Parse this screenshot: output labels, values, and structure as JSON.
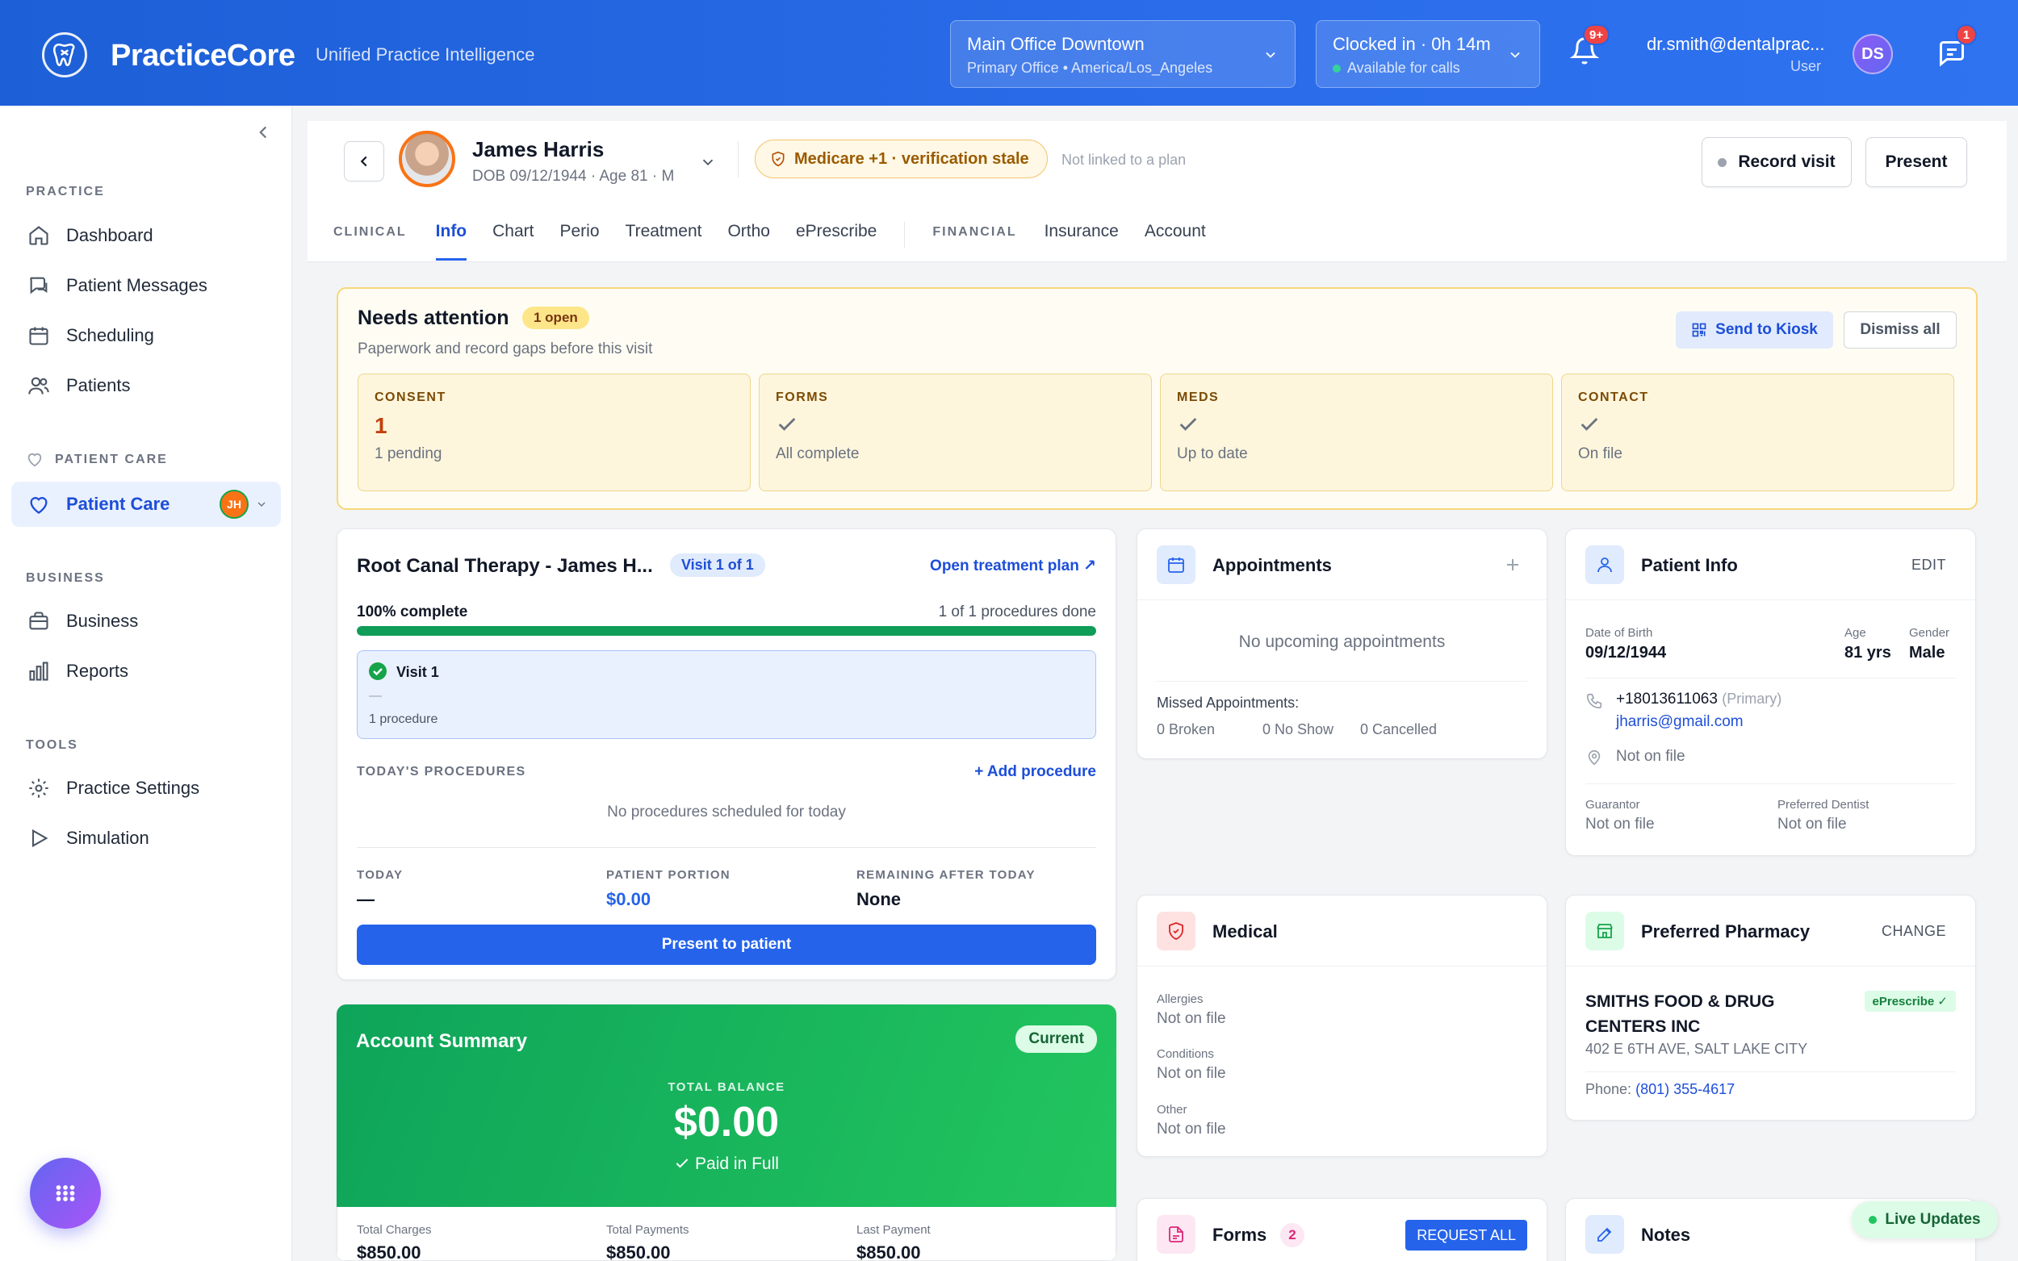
{
  "app": {
    "name": "PracticeCore",
    "tagline": "Unified Practice Intelligence"
  },
  "topbar": {
    "office": {
      "name": "Main Office Downtown",
      "detail": "Primary Office • America/Los_Angeles"
    },
    "clock": {
      "status": "Clocked in · 0h 14m",
      "availability": "Available for calls"
    },
    "notifications_badge": "9+",
    "user": {
      "email": "dr.smith@dentalprac...",
      "role": "User",
      "initials": "DS"
    },
    "messages_badge": "1"
  },
  "sidebar": {
    "sections": {
      "practice": "PRACTICE",
      "patient_care": "PATIENT CARE",
      "business": "BUSINESS",
      "tools": "TOOLS"
    },
    "items": {
      "dashboard": "Dashboard",
      "messages": "Patient Messages",
      "scheduling": "Scheduling",
      "patients": "Patients",
      "patient_care": "Patient Care",
      "patient_care_initials": "JH",
      "business": "Business",
      "reports": "Reports",
      "settings": "Practice Settings",
      "simulation": "Simulation"
    }
  },
  "patient": {
    "name": "James Harris",
    "dob_line": "DOB 09/12/1944 · Age 81 · M",
    "insurance_badge": "Medicare +1 · verification stale",
    "plan_note": "Not linked to a plan",
    "record_visit": "Record visit",
    "present": "Present"
  },
  "tabs": {
    "clinical": "CLINICAL",
    "info": "Info",
    "chart": "Chart",
    "perio": "Perio",
    "treatment": "Treatment",
    "ortho": "Ortho",
    "eprescribe": "ePrescribe",
    "financial": "FINANCIAL",
    "insurance": "Insurance",
    "account": "Account"
  },
  "attention": {
    "title": "Needs attention",
    "count": "1 open",
    "subtitle": "Paperwork and record gaps before this visit",
    "kiosk": "Send to Kiosk",
    "dismiss": "Dismiss all",
    "cards": {
      "consent": {
        "label": "CONSENT",
        "value": "1",
        "sub": "1 pending"
      },
      "forms": {
        "label": "FORMS",
        "sub": "All complete"
      },
      "meds": {
        "label": "MEDS",
        "sub": "Up to date"
      },
      "contact": {
        "label": "CONTACT",
        "sub": "On file"
      }
    }
  },
  "treatment": {
    "title": "Root Canal Therapy - James H...",
    "visit_badge": "Visit 1 of 1",
    "open_link": "Open treatment plan ↗",
    "progress_label": "100% complete",
    "progress_detail": "1 of 1 procedures done",
    "progress": 1.0,
    "visit_name": "Visit 1",
    "visit_dash": "—",
    "visit_procs": "1 procedure",
    "todays_label": "TODAY'S PROCEDURES",
    "add": "+ Add procedure",
    "empty": "No procedures scheduled for today",
    "today_lbl": "TODAY",
    "today_val": "—",
    "portion_lbl": "PATIENT PORTION",
    "portion_val": "$0.00",
    "remaining_lbl": "REMAINING AFTER TODAY",
    "remaining_val": "None",
    "present_btn": "Present to patient"
  },
  "account": {
    "title": "Account Summary",
    "status": "Current",
    "balance_lbl": "TOTAL BALANCE",
    "balance": "$0.00",
    "paid": "Paid in Full",
    "charges_lbl": "Total Charges",
    "charges": "$850.00",
    "payments_lbl": "Total Payments",
    "payments": "$850.00",
    "last_lbl": "Last Payment",
    "last": "$850.00"
  },
  "appointments": {
    "title": "Appointments",
    "empty": "No upcoming appointments",
    "missed_lbl": "Missed Appointments:",
    "broken": "0 Broken",
    "noshow": "0 No Show",
    "cancelled": "0 Cancelled"
  },
  "medical": {
    "title": "Medical",
    "allergies_lbl": "Allergies",
    "allergies": "Not on file",
    "conditions_lbl": "Conditions",
    "conditions": "Not on file",
    "other_lbl": "Other",
    "other": "Not on file"
  },
  "forms": {
    "title": "Forms",
    "count": "2",
    "request": "REQUEST ALL"
  },
  "patient_info": {
    "title": "Patient Info",
    "edit": "EDIT",
    "dob_lbl": "Date of Birth",
    "dob": "09/12/1944",
    "age_lbl": "Age",
    "age": "81 yrs",
    "gender_lbl": "Gender",
    "gender": "Male",
    "phone": "+18013611063",
    "phone_tag": "(Primary)",
    "email": "jharris@gmail.com",
    "address": "Not on file",
    "guarantor_lbl": "Guarantor",
    "guarantor": "Not on file",
    "dentist_lbl": "Preferred Dentist",
    "dentist": "Not on file"
  },
  "pharmacy": {
    "title": "Preferred Pharmacy",
    "change": "CHANGE",
    "name_l1": "SMITHS FOOD & DRUG",
    "name_l2": "CENTERS INC",
    "address": "402 E 6TH AVE, SALT LAKE CITY",
    "tag": "ePrescribe ✓",
    "phone_lbl": "Phone:",
    "phone": "(801) 355-4617"
  },
  "notes": {
    "title": "Notes"
  },
  "live": "Live Updates",
  "colors": {
    "primary": "#2563eb",
    "success": "#16a34a",
    "warning_bg": "#fdf6dd",
    "danger": "#ef4444"
  }
}
